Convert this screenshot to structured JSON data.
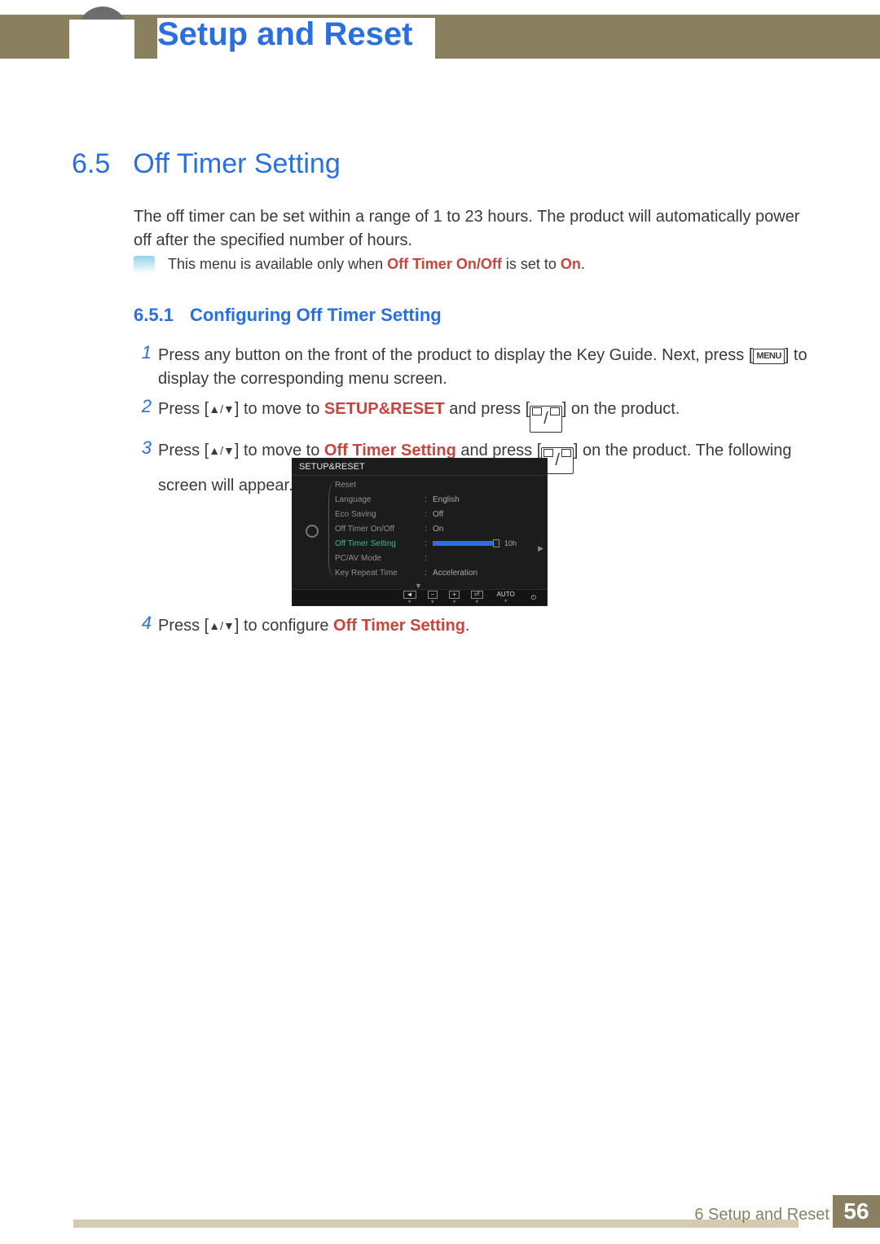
{
  "header": {
    "chapter_title": "Setup and Reset"
  },
  "section": {
    "num": "6.5",
    "title": "Off Timer Setting"
  },
  "intro": "The off timer can be set within a range of 1 to 23 hours. The product will automatically power off after the specified number of hours.",
  "note": {
    "prefix": "This menu is available only when ",
    "bold1": "Off Timer On/Off",
    "mid": " is set to ",
    "bold2": "On",
    "suffix": "."
  },
  "subsection": {
    "num": "6.5.1",
    "title": "Configuring Off Timer Setting"
  },
  "steps": {
    "s1a": "Press any button on the front of the product to display the Key Guide. Next, press [",
    "s1_menu": "MENU",
    "s1b": "] to display the corresponding menu screen.",
    "s2a": "Press [",
    "s2b": "] to move to ",
    "s2_red": "SETUP&RESET",
    "s2c": " and press [",
    "s2d": "] on the product.",
    "s3a": "Press [",
    "s3b": "] to move to ",
    "s3_red": "Off Timer Setting",
    "s3c": " and press [",
    "s3d": "] on the product. The following screen will appear.",
    "s4a": "Press [",
    "s4b": "] to configure ",
    "s4_red": "Off Timer Setting",
    "s4c": "."
  },
  "osd": {
    "title": "SETUP&RESET",
    "rows": [
      {
        "label": "Reset",
        "val": ""
      },
      {
        "label": "Language",
        "val": "English"
      },
      {
        "label": "Eco Saving",
        "val": "Off"
      },
      {
        "label": "Off Timer On/Off",
        "val": "On"
      },
      {
        "label": "Off Timer Setting",
        "val": "10h",
        "selected": true,
        "slider": true
      },
      {
        "label": "PC/AV Mode",
        "val": ""
      },
      {
        "label": "Key Repeat Time",
        "val": "Acceleration"
      }
    ],
    "footer_buttons": [
      "◄",
      "−",
      "+",
      "⏎",
      "AUTO",
      "⏻"
    ]
  },
  "footer": {
    "section": "6 Setup and Reset",
    "page": "56"
  }
}
